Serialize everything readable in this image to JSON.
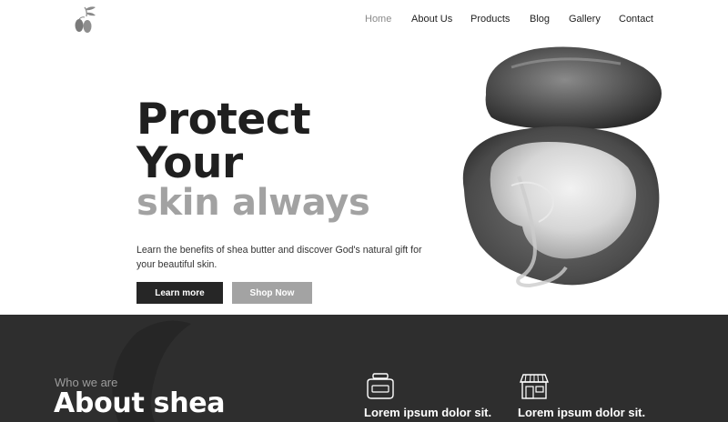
{
  "brand": {
    "logo_icon": "shea-branch-logo-icon"
  },
  "nav": {
    "items": [
      {
        "label": "Home",
        "active": true
      },
      {
        "label": "About Us",
        "active": false
      },
      {
        "label": "Products",
        "active": false
      },
      {
        "label": "Blog",
        "active": false
      },
      {
        "label": "Gallery",
        "active": false
      },
      {
        "label": "Contact",
        "active": false
      }
    ]
  },
  "hero": {
    "title_line1": "Protect",
    "title_line2": "Your",
    "subtitle": "skin always",
    "description": "Learn the benefits of shea butter and discover God's natural gift for your beautiful skin.",
    "learn_more_label": "Learn more",
    "shop_now_label": "Shop Now",
    "image": "shea-nut-photo"
  },
  "about": {
    "eyebrow": "Who we are",
    "heading": "About shea",
    "features": [
      {
        "icon": "cream-jar-icon",
        "text": "Lorem ipsum dolor sit."
      },
      {
        "icon": "storefront-icon",
        "text": "Lorem ipsum dolor sit."
      }
    ]
  },
  "colors": {
    "dark_section": "#2e2e2e",
    "primary_button": "#262626",
    "secondary_button": "#a3a3a3",
    "subtitle_gray": "#a2a2a2"
  }
}
